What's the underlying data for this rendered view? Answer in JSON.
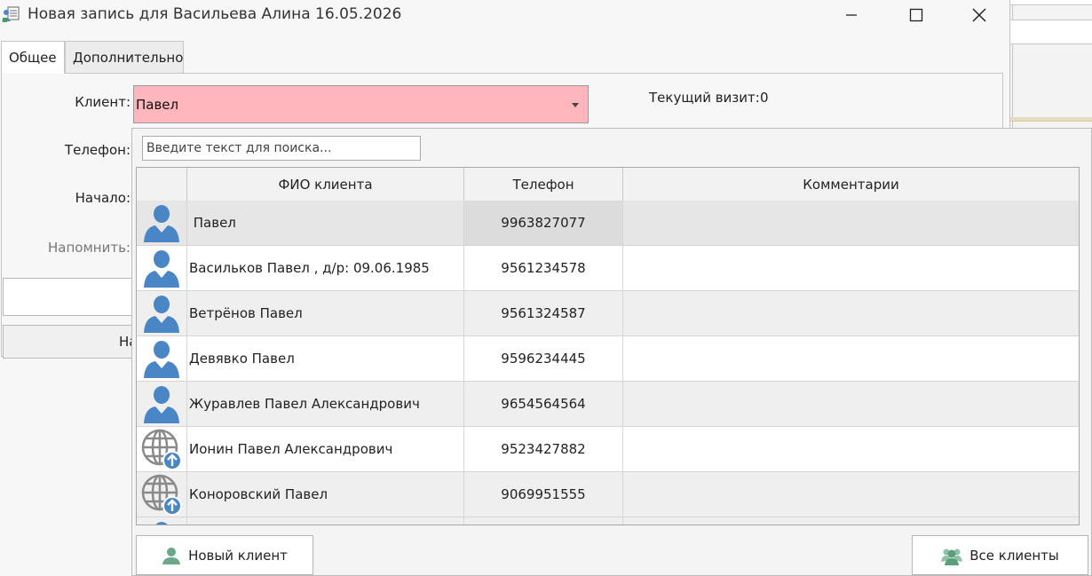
{
  "window": {
    "title": "Новая запись для Васильева Алина 16.05.2026"
  },
  "tabs": [
    {
      "label": "Общее"
    },
    {
      "label": "Дополнительно"
    }
  ],
  "form": {
    "client_label": "Клиент:",
    "client_value": "Павел",
    "phone_label": "Телефон:",
    "start_label": "Начало:",
    "remind_label": "Напомнить:",
    "current_visit_label": "Текущий визит:",
    "current_visit_value": "0",
    "left_button_partial": "На"
  },
  "popup": {
    "search_placeholder": "Введите текст для поиска...",
    "columns": {
      "name": "ФИО клиента",
      "phone": "Телефон",
      "comments": "Комментарии"
    },
    "rows": [
      {
        "icon": "user-icon",
        "name": " Павел",
        "phone": "9963827077",
        "comment": ""
      },
      {
        "icon": "user-icon",
        "name": "Васильков Павел , д/р: 09.06.1985",
        "phone": "9561234578",
        "comment": ""
      },
      {
        "icon": "user-icon",
        "name": "Ветрёнов Павел",
        "phone": "9561324587",
        "comment": ""
      },
      {
        "icon": "user-icon",
        "name": "Девявко Павел",
        "phone": "9596234445",
        "comment": ""
      },
      {
        "icon": "user-icon",
        "name": "Журавлев Павел Александрович",
        "phone": "9654564564",
        "comment": ""
      },
      {
        "icon": "globe-upload-icon",
        "name": "Ионин Павел Александрович",
        "phone": "9523427882",
        "comment": ""
      },
      {
        "icon": "globe-upload-icon",
        "name": "Коноровский Павел",
        "phone": "9069951555",
        "comment": ""
      }
    ],
    "new_client_label": "Новый клиент",
    "all_clients_label": "Все клиенты"
  },
  "colors": {
    "client_field_error": "#ffb7bd",
    "user_icon": "#4a86c5",
    "green_icon": "#6aa889"
  }
}
